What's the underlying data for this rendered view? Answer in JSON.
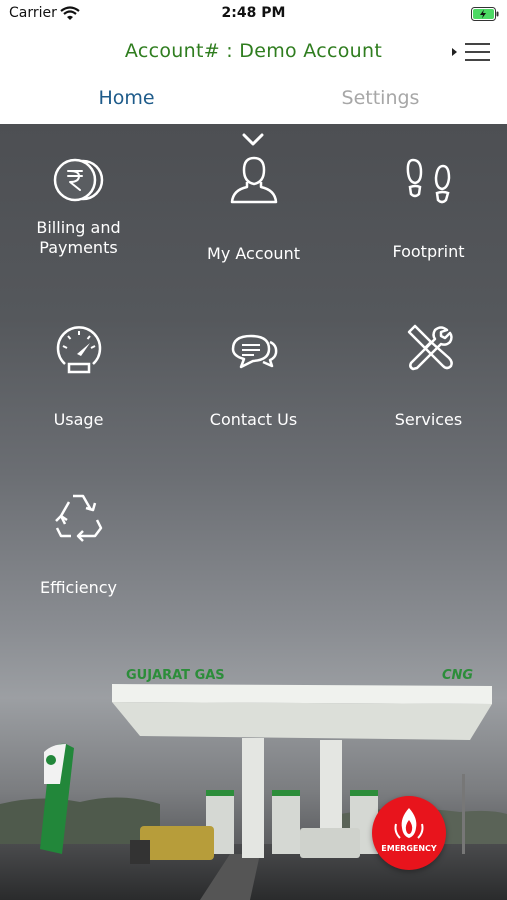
{
  "status_bar": {
    "carrier": "Carrier",
    "time": "2:48 PM"
  },
  "header": {
    "account_title": "Account# : Demo Account"
  },
  "tabs": [
    {
      "label": "Home",
      "selected": true
    },
    {
      "label": "Settings",
      "selected": false
    }
  ],
  "tiles": [
    {
      "label_line1": "Billing and",
      "label_line2": "Payments",
      "icon": "rupee-coins-icon"
    },
    {
      "label": "My Account",
      "icon": "user-icon"
    },
    {
      "label": "Footprint",
      "icon": "footprint-icon"
    },
    {
      "label": "Usage",
      "icon": "gauge-icon"
    },
    {
      "label": "Contact Us",
      "icon": "chat-bubbles-icon"
    },
    {
      "label": "Services",
      "icon": "tools-icon"
    },
    {
      "label": "Efficiency",
      "icon": "recycle-icon"
    }
  ],
  "station_sign": {
    "brand": "GUJARAT GAS",
    "product": "CNG"
  },
  "emergency_button": {
    "label": "EMERGENCY"
  },
  "colors": {
    "account_title": "#2f7d1f",
    "tab_active": "#1e5b8a",
    "tab_inactive": "#a7a7a7",
    "emergency": "#e8141c"
  }
}
